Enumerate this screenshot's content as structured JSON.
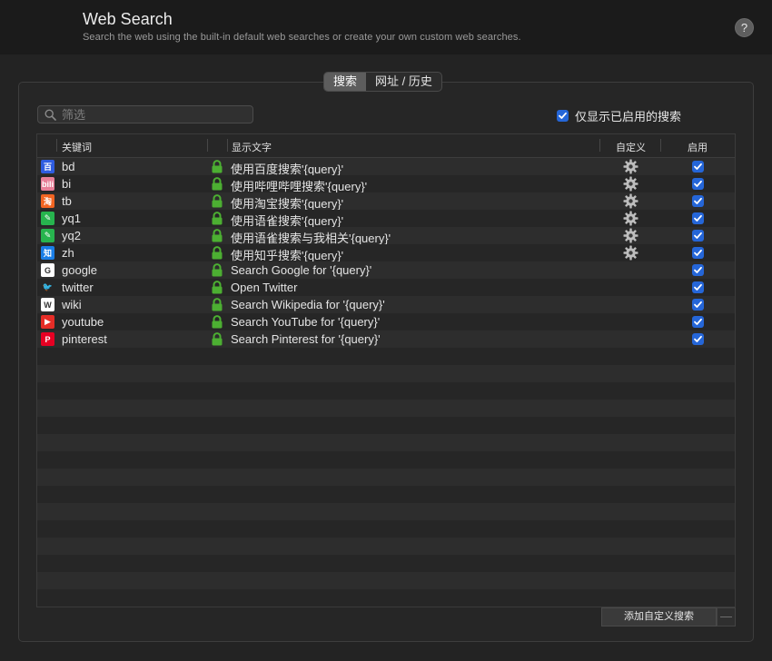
{
  "header": {
    "title": "Web Search",
    "subtitle": "Search the web using the built-in default web searches or create your own custom web searches.",
    "help_label": "?"
  },
  "tabs": [
    {
      "label": "搜索",
      "active": true
    },
    {
      "label": "网址 / 历史",
      "active": false
    }
  ],
  "filter": {
    "placeholder": "筛选",
    "value": ""
  },
  "only_enabled": {
    "label": "仅显示已启用的搜索",
    "checked": true
  },
  "columns": {
    "keyword": "关键词",
    "display": "显示文字",
    "custom": "自定义",
    "enabled": "启用"
  },
  "rows": [
    {
      "icon": "baidu-icon",
      "icon_text": "百",
      "icon_bg": "#2f5de0",
      "keyword": "bd",
      "display": "使用百度搜索'{query}'",
      "custom": true,
      "enabled": true
    },
    {
      "icon": "bilibili-icon",
      "icon_text": "bili",
      "icon_bg": "#e87f98",
      "keyword": "bi",
      "display": "使用哔哩哔哩搜索'{query}'",
      "custom": true,
      "enabled": true
    },
    {
      "icon": "taobao-icon",
      "icon_text": "淘",
      "icon_bg": "#f26522",
      "keyword": "tb",
      "display": "使用淘宝搜索'{query}'",
      "custom": true,
      "enabled": true
    },
    {
      "icon": "yuque-icon",
      "icon_text": "✎",
      "icon_bg": "#27b44e",
      "keyword": "yq1",
      "display": "使用语雀搜索'{query}'",
      "custom": true,
      "enabled": true
    },
    {
      "icon": "yuque-icon",
      "icon_text": "✎",
      "icon_bg": "#27b44e",
      "keyword": "yq2",
      "display": "使用语雀搜索与我相关'{query}'",
      "custom": true,
      "enabled": true
    },
    {
      "icon": "zhihu-icon",
      "icon_text": "知",
      "icon_bg": "#1a7ee6",
      "keyword": "zh",
      "display": "使用知乎搜索'{query}'",
      "custom": true,
      "enabled": true
    },
    {
      "icon": "google-icon",
      "icon_text": "G",
      "icon_bg": "#ffffff",
      "keyword": "google",
      "display": "Search Google for '{query}'",
      "custom": false,
      "enabled": true
    },
    {
      "icon": "twitter-icon",
      "icon_text": "🐦",
      "icon_bg": "transparent",
      "keyword": "twitter",
      "display": "Open Twitter",
      "custom": false,
      "enabled": true
    },
    {
      "icon": "wikipedia-icon",
      "icon_text": "W",
      "icon_bg": "#ffffff",
      "keyword": "wiki",
      "display": "Search Wikipedia for '{query}'",
      "custom": false,
      "enabled": true
    },
    {
      "icon": "youtube-icon",
      "icon_text": "▶",
      "icon_bg": "#e52d27",
      "keyword": "youtube",
      "display": "Search YouTube for '{query}'",
      "custom": false,
      "enabled": true
    },
    {
      "icon": "pinterest-icon",
      "icon_text": "P",
      "icon_bg": "#e60023",
      "keyword": "pinterest",
      "display": "Search Pinterest for '{query}'",
      "custom": false,
      "enabled": true
    }
  ],
  "add_button_label": "添加自定义搜索",
  "remove_button_label": "—",
  "colors": {
    "accent": "#2566d8",
    "lock": "#4caf32"
  }
}
